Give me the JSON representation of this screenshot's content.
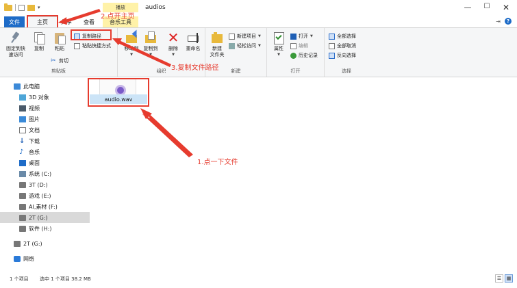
{
  "titlebar": {
    "context_tab": "播放",
    "title": "audios",
    "minimize": "—",
    "maximize": "☐",
    "close": "✕"
  },
  "tabs": {
    "file": "文件",
    "home": "主页",
    "share": "共享",
    "view": "查看",
    "music_tools": "音乐工具"
  },
  "ribbon": {
    "clipboard": {
      "label": "剪贴板",
      "pin": "固定到快\n速访问",
      "copy": "复制",
      "paste": "粘贴",
      "copy_path": "复制路径",
      "paste_shortcut": "粘贴快捷方式",
      "cut": "剪切"
    },
    "organize": {
      "label": "组织",
      "move_to": "移动到",
      "copy_to": "复制到",
      "delete": "删除",
      "rename": "重命名"
    },
    "new": {
      "label": "新建",
      "new_folder": "新建\n文件夹",
      "new_item": "新建项目",
      "easy_access": "轻松访问"
    },
    "open": {
      "label": "打开",
      "properties": "属性",
      "open": "打开",
      "edit": "编辑",
      "history": "历史记录"
    },
    "select": {
      "label": "选择",
      "select_all": "全部选择",
      "select_none": "全部取消",
      "invert": "反向选择"
    }
  },
  "nav": {
    "items": [
      {
        "label": "此电脑",
        "icon": "pc-icon"
      },
      {
        "label": "3D 对象",
        "icon": "3d-objects-icon"
      },
      {
        "label": "视频",
        "icon": "video-icon"
      },
      {
        "label": "图片",
        "icon": "pictures-icon"
      },
      {
        "label": "文档",
        "icon": "documents-icon"
      },
      {
        "label": "下载",
        "icon": "download-icon"
      },
      {
        "label": "音乐",
        "icon": "music-icon"
      },
      {
        "label": "桌面",
        "icon": "desktop-icon"
      },
      {
        "label": "系统 (C:)",
        "icon": "system-drive-icon"
      },
      {
        "label": "3T (D:)",
        "icon": "drive-icon"
      },
      {
        "label": "游戏 (E:)",
        "icon": "drive-icon"
      },
      {
        "label": "AI,素材 (F:)",
        "icon": "drive-icon"
      },
      {
        "label": "2T (G:)",
        "icon": "drive-icon"
      },
      {
        "label": "软件 (H:)",
        "icon": "drive-icon"
      },
      {
        "label": "2T (G:)",
        "icon": "drive-icon"
      },
      {
        "label": "网络",
        "icon": "network-icon"
      }
    ]
  },
  "file": {
    "name": "audio.wav"
  },
  "annotations": {
    "step1": "1.点一下文件",
    "step2": "2.点开主页",
    "step3": "3.复制文件路径"
  },
  "status": {
    "count": "1 个项目",
    "selected": "选中 1 个项目  38.2 MB"
  },
  "colors": {
    "accent": "#1e6cc8",
    "annotation_red": "#e63b2e",
    "context_yellow": "#fff2a8",
    "selection": "#cce4f7"
  }
}
